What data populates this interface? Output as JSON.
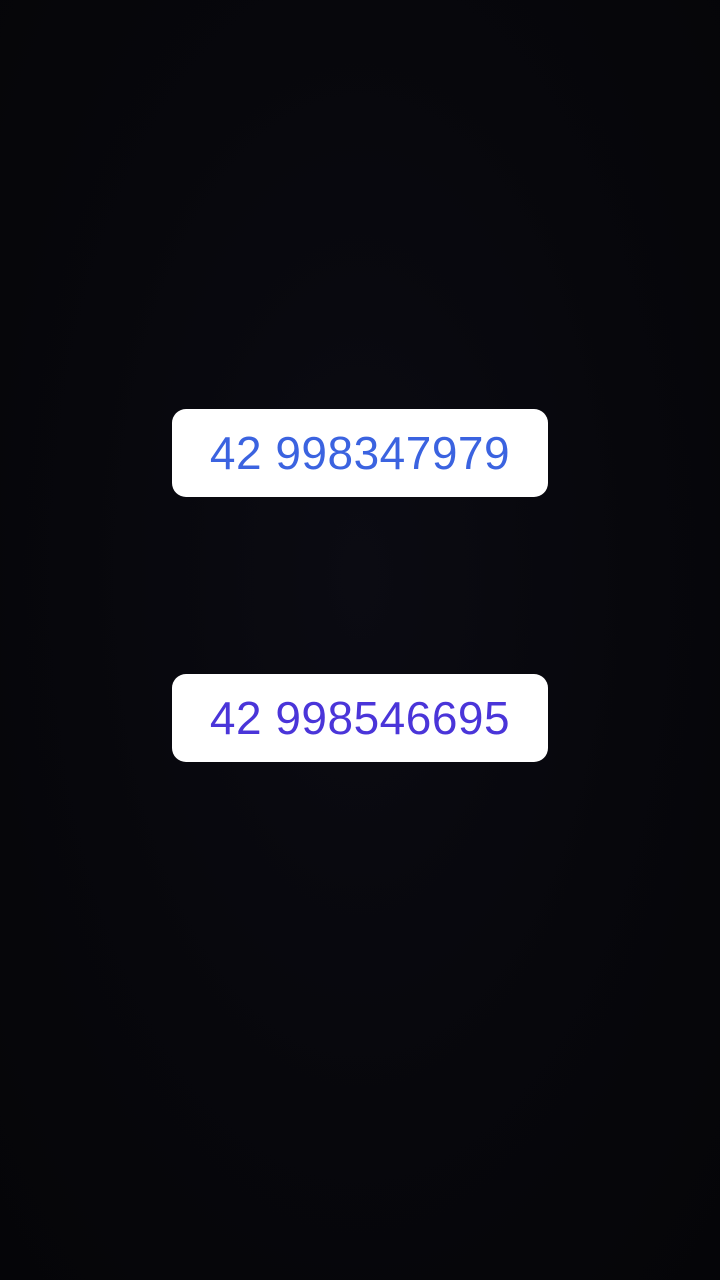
{
  "sticker_texts": [
    {
      "text": "42 998347979",
      "color": "#3b63e0"
    },
    {
      "text": "42 998546695",
      "color": "#4a35d9"
    }
  ],
  "colors": {
    "background": "#06060b",
    "chip_background": "#ffffff"
  }
}
